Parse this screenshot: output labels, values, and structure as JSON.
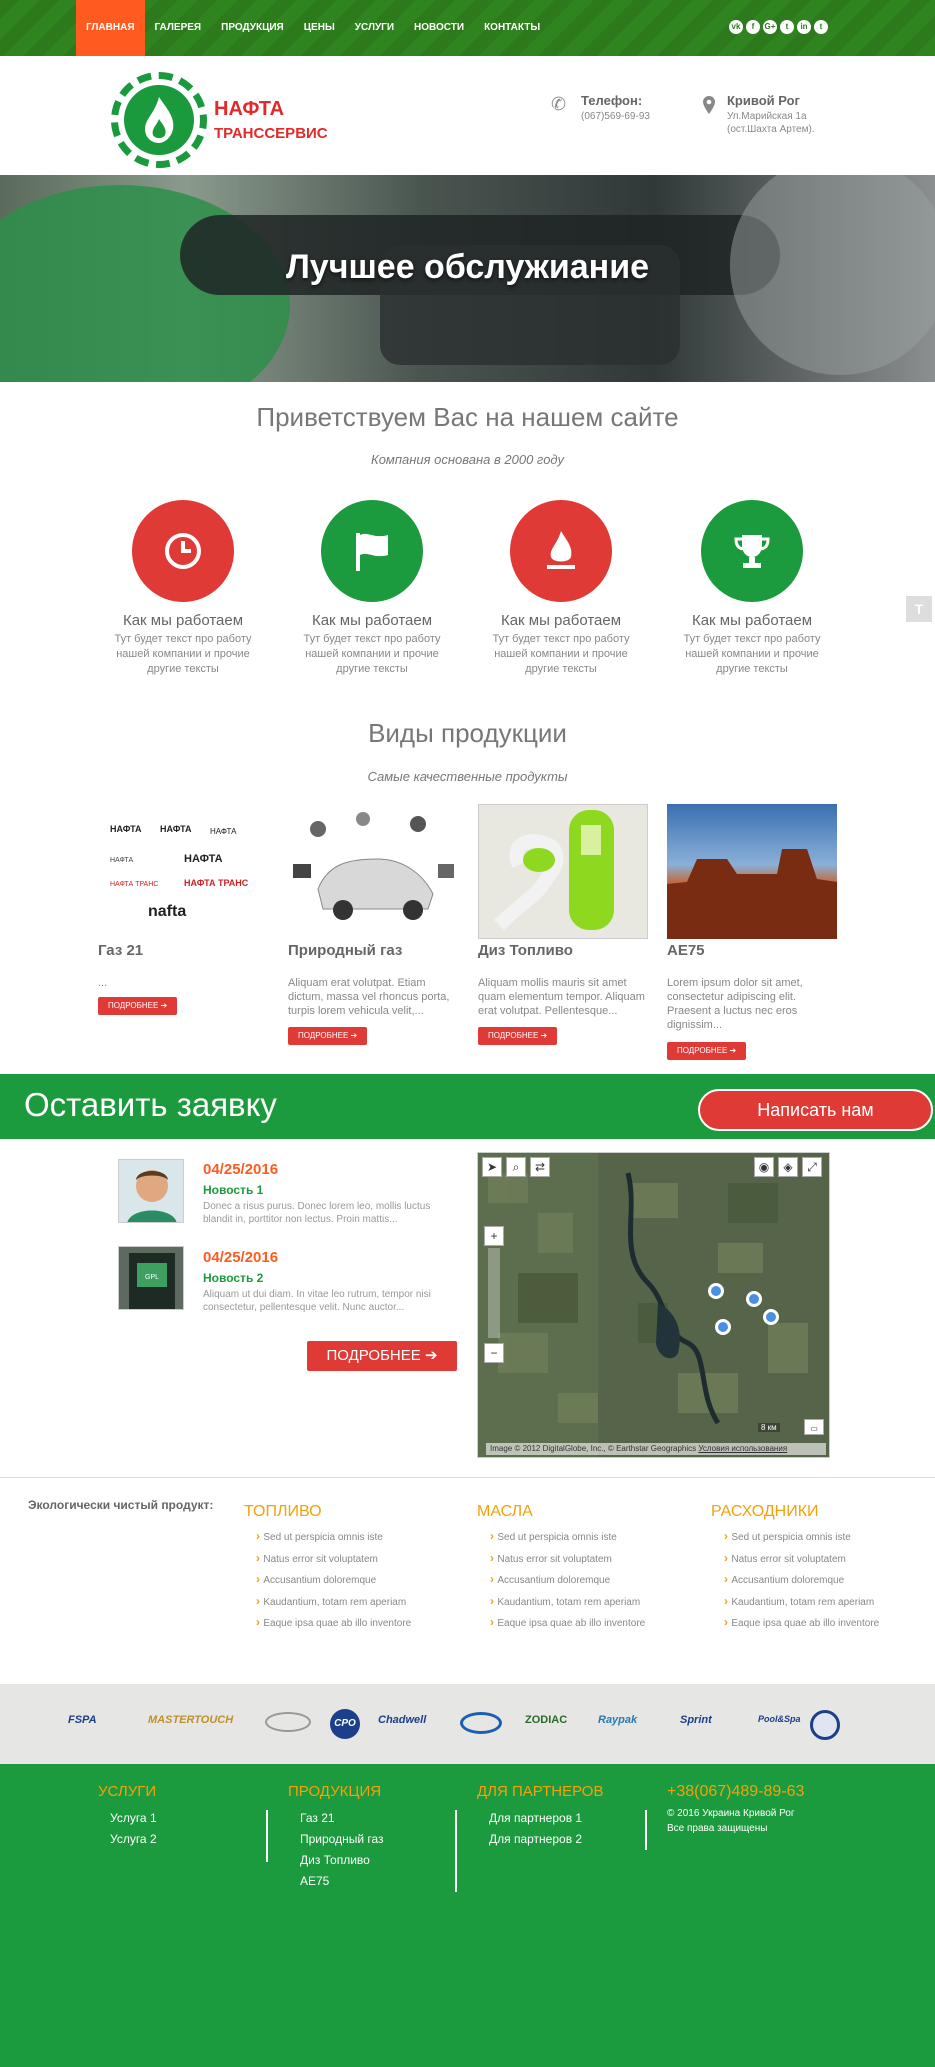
{
  "nav": {
    "items": [
      "Главная",
      "Галерея",
      "Продукция",
      "Цены",
      "Услуги",
      "Новости",
      "Контакты"
    ],
    "social": [
      "vk",
      "f",
      "G+",
      "t",
      "in",
      "t"
    ]
  },
  "header": {
    "logo_line1": "НАФТА",
    "logo_line2": "ТРАНССЕРВИС",
    "phone_title": "Телефон:",
    "phone": "(067)569-69-93",
    "city": "Кривой Рог",
    "address1": "Ул.Марийская 1а",
    "address2": "(ост.Шахта Артем)."
  },
  "hero": {
    "title": "Лучшее обслужиание"
  },
  "welcome": {
    "title": "Приветствуем Вас на нашем сайте",
    "subtitle": "Компания основана в 2000 году",
    "features": [
      {
        "title": "Как мы работаем",
        "text": "Тут будет текст про работу нашей компании и прочие другие тексты",
        "icon": "clock-icon",
        "color": "#e03a36"
      },
      {
        "title": "Как мы работаем",
        "text": "Тут будет текст про работу нашей компании и прочие другие тексты",
        "icon": "flag-icon",
        "color": "#1c9a3e"
      },
      {
        "title": "Как мы работаем",
        "text": "Тут будет текст про работу нашей компании и прочие другие тексты",
        "icon": "fire-icon",
        "color": "#e03a36"
      },
      {
        "title": "Как мы работаем",
        "text": "Тут будет текст про работу нашей компании и прочие другие тексты",
        "icon": "trophy-icon",
        "color": "#1c9a3e"
      }
    ]
  },
  "products": {
    "title": "Виды продукции",
    "subtitle": "Самые качественные продукты",
    "more_label": "Подробнее ➔",
    "items": [
      {
        "title": "Газ 21",
        "text": "..."
      },
      {
        "title": "Природный газ",
        "text": " Aliquam erat volutpat. Etiam dictum, massa vel rhoncus porta, turpis lorem vehicula velit,..."
      },
      {
        "title": "Диз Топливо",
        "text": " Aliquam mollis mauris sit amet quam elementum tempor. Aliquam erat volutpat. Pellentesque..."
      },
      {
        "title": "АЕ75",
        "text": " Lorem ipsum dolor sit amet, consectetur adipiscing elit. Praesent a luctus nec eros dignissim..."
      }
    ]
  },
  "cta": {
    "title": "Оставить заявку",
    "button": "Написать нам"
  },
  "news": {
    "items": [
      {
        "date": "04/25/2016",
        "title": "Новость 1",
        "text": "Donec a risus purus. Donec lorem leo, mollis luctus blandit in, porttitor non lectus. Proin mattis..."
      },
      {
        "date": "04/25/2016",
        "title": "Новость 2",
        "text": "Aliquam ut dui diam. In vitae leo rutrum, tempor nisi consectetur, pellentesque velit. Nunc auctor..."
      }
    ],
    "more_label": "ПОДРОБНЕЕ ➔"
  },
  "map": {
    "attribution": "Image © 2012 DigitalGlobe, Inc., © Earthstar Geographics",
    "terms": "Условия использования",
    "scale": "8 км"
  },
  "eco": {
    "label": "Экологически чистый продукт:",
    "columns": [
      {
        "title": "Топливо",
        "items": [
          "Sed ut perspicia omnis iste",
          "Natus error sit voluptatem",
          "Accusantium doloremque",
          "Kaudantium, totam rem aperiam",
          "Eaque ipsa quae ab illo inventore"
        ]
      },
      {
        "title": "Масла",
        "items": [
          "Sed ut perspicia omnis iste",
          "Natus error sit voluptatem",
          "Accusantium doloremque",
          "Kaudantium, totam rem aperiam",
          "Eaque ipsa quae ab illo inventore"
        ]
      },
      {
        "title": "Расходники",
        "items": [
          "Sed ut perspicia omnis iste",
          "Natus error sit voluptatem",
          "Accusantium doloremque",
          "Kaudantium, totam rem aperiam",
          "Eaque ipsa quae ab illo inventore"
        ]
      }
    ]
  },
  "partners": [
    "FSPA",
    "MASTERTOUCH",
    "CPO",
    "Chadwell",
    "ZODIAC",
    "Raypak",
    "Sprint",
    "Pool&Spa"
  ],
  "footer": {
    "services_title": "Услуги",
    "services": [
      "Услуга 1",
      "Услуга 2"
    ],
    "products_title": "Продукция",
    "products": [
      "Газ 21",
      "Природный газ",
      "Диз Топливо",
      "АЕ75"
    ],
    "partners_title": "Для партнеров",
    "partners": [
      "Для партнеров 1",
      "Для партнеров 2"
    ],
    "phone": "+38(067)489-89-63",
    "copyright1": "© 2016 Украина Кривой Рог",
    "copyright2": "Все права защищены"
  }
}
